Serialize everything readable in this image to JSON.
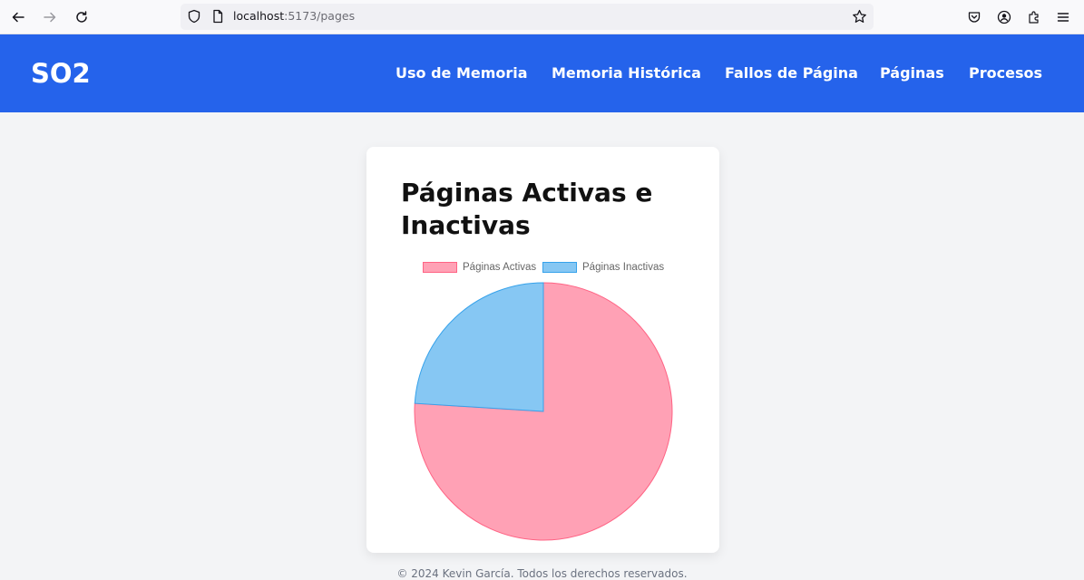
{
  "browser": {
    "url_host": "localhost",
    "url_path": ":5173/pages"
  },
  "header": {
    "brand": "SO2",
    "nav": [
      "Uso de Memoria",
      "Memoria Histórica",
      "Fallos de Página",
      "Páginas",
      "Procesos"
    ]
  },
  "card": {
    "title": "Páginas Activas e Inactivas"
  },
  "chart_data": {
    "type": "pie",
    "title": "",
    "labels": [
      "Páginas Activas",
      "Páginas Inactivas"
    ],
    "values": [
      76,
      24
    ],
    "colors": [
      "#ffa1b5",
      "#86c7f3"
    ],
    "border_colors": [
      "#ff6384",
      "#36a2eb"
    ],
    "legend": "top"
  },
  "footer": {
    "text": "© 2024 Kevin García. Todos los derechos reservados."
  }
}
